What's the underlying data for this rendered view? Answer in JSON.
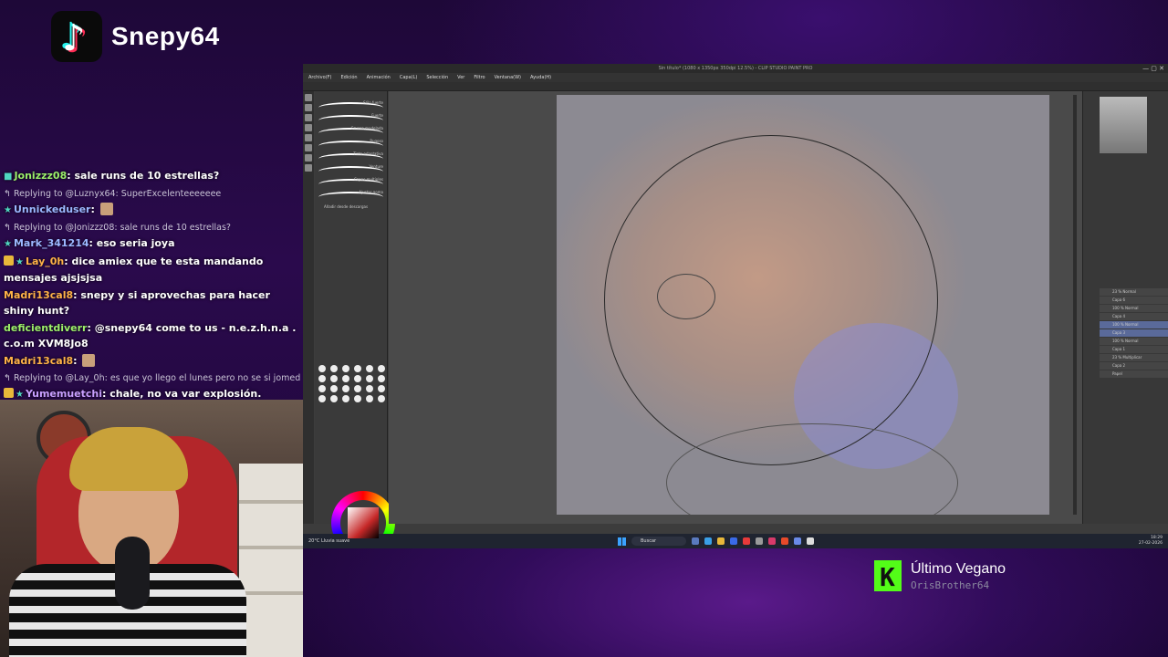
{
  "brand": {
    "name": "Snepy64"
  },
  "chat": [
    {
      "type": "msg",
      "user": "Jonizzz08",
      "text": "sale runs de 10 estrellas?"
    },
    {
      "type": "reply",
      "text": "Replying to @Luznyx64: SuperExcelenteeeeeee"
    },
    {
      "type": "msg",
      "user": "Unnickeduser",
      "text": ""
    },
    {
      "type": "reply",
      "text": "Replying to @Jonizzz08: sale runs de 10 estrellas?"
    },
    {
      "type": "msg",
      "user": "Mark_341214",
      "text": "eso seria joya"
    },
    {
      "type": "msg",
      "user": "Lay_0h",
      "text": "dice amiex que te esta mandando mensajes ajsjsjsa"
    },
    {
      "type": "msg",
      "user": "Madri13cal8",
      "text": "snepy y si aprovechas para hacer shiny hunt?"
    },
    {
      "type": "msg",
      "user": "deficientdiverr",
      "text": "@snepy64 come to us - n.e.z.h.n.a . c.o.m XVM8Jo8"
    },
    {
      "type": "msg",
      "user": "Madri13cal8",
      "text": ""
    },
    {
      "type": "reply",
      "text": "Replying to @Lay_0h: es que yo llego el lunes pero no se si jomed..."
    },
    {
      "type": "msg",
      "user": "Yumemuetchi",
      "text": "chale, no va var explosión."
    }
  ],
  "app": {
    "title": "Sin título* (1080 x 1350px 350dpi 12.5%) - CLIP STUDIO PAINT PRO",
    "menu": [
      "Archivo(F)",
      "Edición",
      "Animación",
      "Capa(L)",
      "Selección",
      "Ver",
      "Filtro",
      "Ventana(W)",
      "Ayuda(H)"
    ],
    "brushes": [
      "Sólo fuerte",
      "Fuerte",
      "Gruesa modelada",
      "Rugoso",
      "Tinta adaptativa",
      "Venture",
      "Capas multiples",
      "Ajustar goma"
    ],
    "brush_footer": "Añadir desde descargas",
    "layers": [
      "23 % Normal",
      "Capa 6",
      "100 % Normal",
      "Capa 4",
      "100 % Normal",
      "Capa 3",
      "100 % Normal",
      "Capa 1",
      "23 % Multiplicar",
      "Capa 2",
      "Papel"
    ],
    "selected_layer_index": 5
  },
  "taskbar": {
    "weather_temp": "20°C",
    "weather_desc": "Lluvia suave",
    "search": "Buscar",
    "time": "18:29",
    "date": "27-02-2026",
    "lang": "ESP LAA"
  },
  "song": {
    "title": "Último Vegano",
    "artist": "OrisBrother64"
  },
  "colors": {
    "accent_kick": "#53fc18",
    "tiktok_cyan": "#25f4ee",
    "tiktok_pink": "#fe2c55"
  }
}
